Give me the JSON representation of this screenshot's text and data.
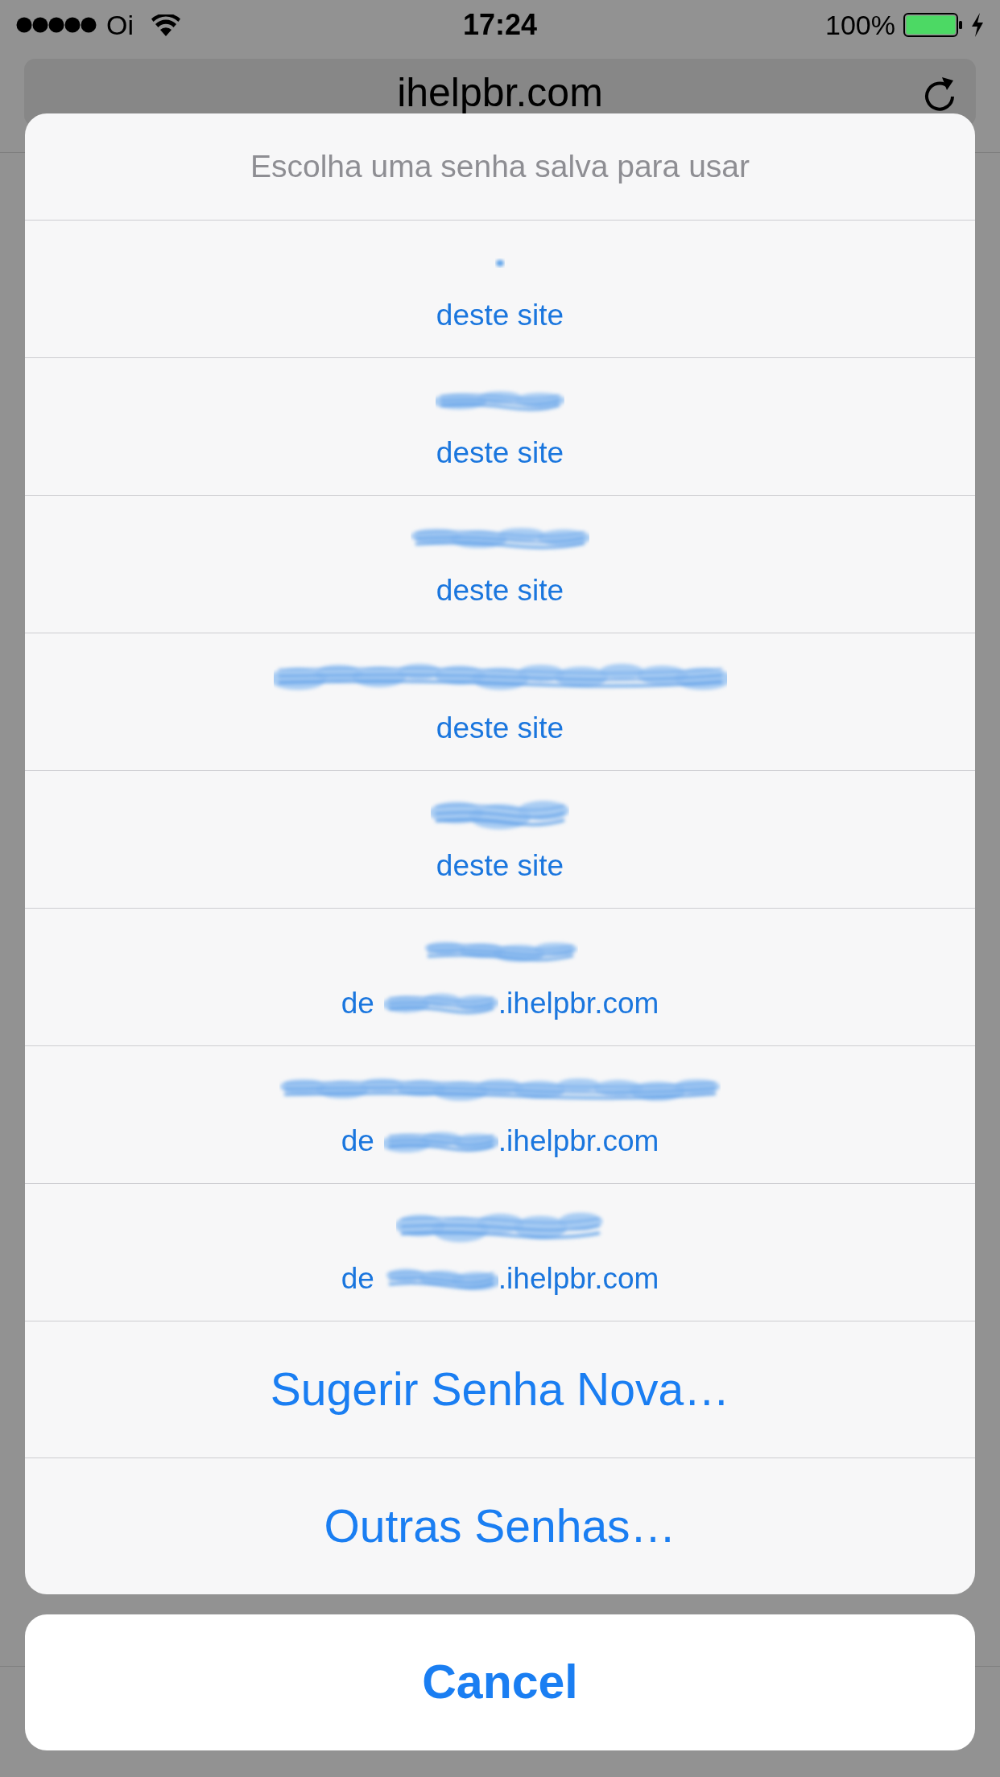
{
  "status_bar": {
    "carrier": "Oi",
    "time": "17:24",
    "battery": "100%",
    "charging": true
  },
  "address_bar": {
    "url": "ihelpbr.com"
  },
  "action_sheet": {
    "title": "Escolha uma senha salva para usar",
    "saved_passwords": [
      {
        "kind": "this_site",
        "source": "deste site"
      },
      {
        "kind": "this_site",
        "source": "deste site"
      },
      {
        "kind": "this_site",
        "source": "deste site"
      },
      {
        "kind": "this_site",
        "source": "deste site"
      },
      {
        "kind": "this_site",
        "source": "deste site"
      },
      {
        "kind": "domain",
        "prefix": "de",
        "suffix": ".ihelpbr.com"
      },
      {
        "kind": "domain",
        "prefix": "de",
        "suffix": ".ihelpbr.com"
      },
      {
        "kind": "domain",
        "prefix": "de",
        "suffix": ".ihelpbr.com"
      }
    ],
    "actions": [
      "Sugerir Senha Nova…",
      "Outras Senhas…"
    ]
  },
  "cancel_button": "Cancel"
}
